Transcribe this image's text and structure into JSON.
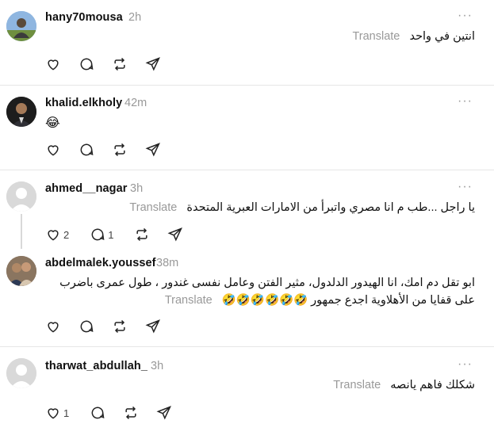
{
  "translate_label": "Translate",
  "more_label": "···",
  "posts": [
    {
      "username": "hany70mousa",
      "time": "2h",
      "text": "انتين في واحد",
      "likes": "",
      "replies": ""
    },
    {
      "username": "khalid.elkholy",
      "time": "42m",
      "text": "😂",
      "likes": "",
      "replies": ""
    },
    {
      "username": "ahmed__nagar",
      "time": "3h",
      "text": "يا راجل ...طب م انا مصري واتبرأ من الامارات العبرية المتحدة",
      "likes": "2",
      "replies": "1"
    },
    {
      "username": "abdelmalek.youssef",
      "time": "38m",
      "text_line1": "ابو تقل دم امك، انا الهيدور الدلدول، مثير الفتن وعامل نفسى غندور ، طول عمرى باضرب",
      "text_line2": "على قفايا من الأهلاوية اجدع جمهور 🤣🤣🤣🤣🤣🤣",
      "likes": "",
      "replies": ""
    },
    {
      "username": "tharwat_abdullah_",
      "time": "3h",
      "text": "شكلك فاهم يانصه",
      "likes": "1",
      "replies": ""
    }
  ],
  "colors": {
    "meta_grey": "#999999",
    "divider": "#e6e6e6"
  }
}
